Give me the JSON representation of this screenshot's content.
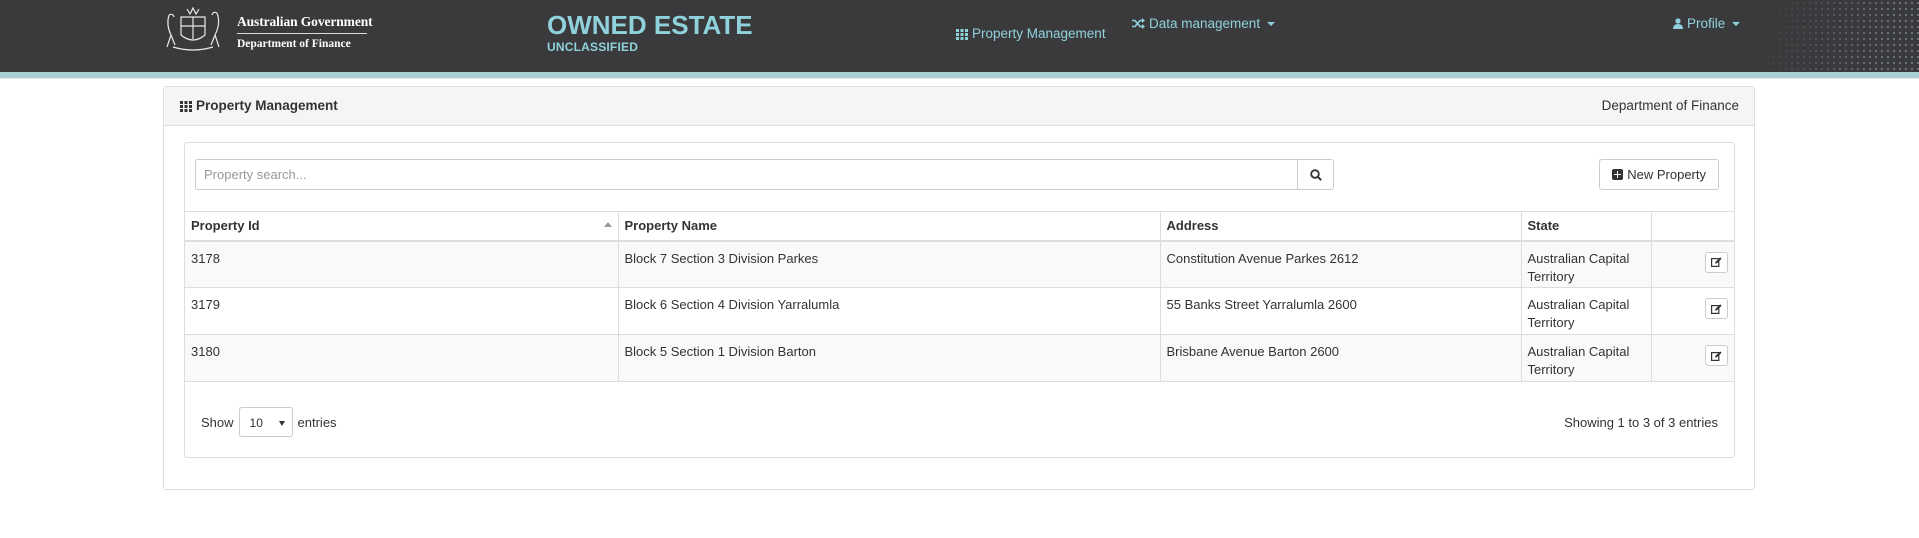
{
  "header": {
    "gov_line1": "Australian Government",
    "gov_line2": "Department of Finance",
    "title": "OWNED ESTATE",
    "classification": "UNCLASSIFIED",
    "nav_property_management": "Property Management",
    "nav_data_management": "Data management",
    "nav_profile": "Profile"
  },
  "panel": {
    "title": "Property Management",
    "organisation": "Department of Finance"
  },
  "search": {
    "placeholder": "Property search...",
    "value": ""
  },
  "actions": {
    "new_property_label": "New Property"
  },
  "table": {
    "columns": [
      "Property Id",
      "Property Name",
      "Address",
      "State"
    ],
    "sorted_column": "Property Id",
    "sort_direction": "ascending",
    "rows": [
      {
        "id": "3178",
        "name": "Block 7 Section 3 Division Parkes",
        "address": "Constitution Avenue Parkes 2612",
        "state": "Australian Capital Territory"
      },
      {
        "id": "3179",
        "name": "Block 6 Section 4 Division Yarralumla",
        "address": "55 Banks Street Yarralumla 2600",
        "state": "Australian Capital Territory"
      },
      {
        "id": "3180",
        "name": "Block 5 Section 1 Division Barton",
        "address": "Brisbane Avenue Barton 2600",
        "state": "Australian Capital Territory"
      }
    ]
  },
  "pagination": {
    "show_label": "Show",
    "page_size": "10",
    "entries_label": "entries",
    "info": "Showing 1 to 3 of 3 entries"
  },
  "colors": {
    "header_bg": "#3a3a3c",
    "accent": "#8fd2dc",
    "accent_strip": "#a9cfd3"
  }
}
